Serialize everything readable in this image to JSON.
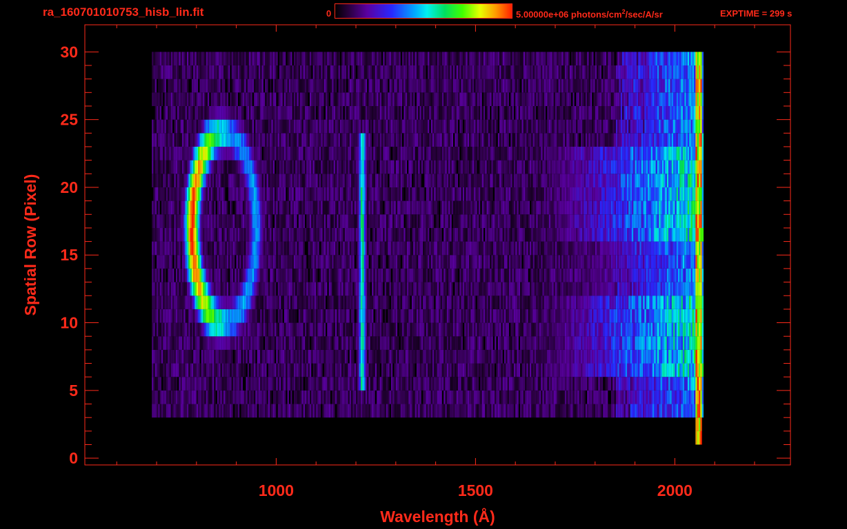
{
  "header": {
    "file_title": "ra_160701010753_hisb_lin.fit",
    "colorbar_min": "0",
    "colorbar_max_prefix": "5.00000e+06 photons/cm",
    "colorbar_max_exp": "2",
    "colorbar_max_suffix": "/sec/A/sr",
    "exptime": "EXPTIME = 299 s"
  },
  "colors": {
    "axis": "#ff2a1a",
    "background": "#000000"
  },
  "chart_data": {
    "type": "heatmap",
    "title": "ra_160701010753_hisb_lin.fit",
    "xlabel": "Wavelength (Å)",
    "ylabel": "Spatial Row (Pixel)",
    "xlim": [
      520,
      2290
    ],
    "ylim": [
      -0.5,
      32
    ],
    "xticks": [
      1000,
      1500,
      2000
    ],
    "yticks": [
      0,
      5,
      10,
      15,
      20,
      25,
      30
    ],
    "colorbar": {
      "min": 0,
      "max": 5000000,
      "units": "photons/cm^2/sec/A/sr",
      "scale": "linear"
    },
    "features": [
      {
        "name": "Lyman-beta/O VI ring",
        "x_center": 870,
        "y_center": 17,
        "x_halfwidth": 80,
        "y_halfwidth": 7,
        "peak": 0.85
      },
      {
        "name": "Lyman-alpha line",
        "x": 1216,
        "y_range": [
          5,
          24
        ],
        "peak": 0.6
      },
      {
        "name": "continuum",
        "x_range": [
          1600,
          2070
        ],
        "y_range": [
          6,
          23
        ],
        "peak": 0.6
      },
      {
        "name": "background",
        "x_range": [
          690,
          2070
        ],
        "y_range": [
          3,
          30
        ],
        "level": 0.12
      }
    ]
  }
}
